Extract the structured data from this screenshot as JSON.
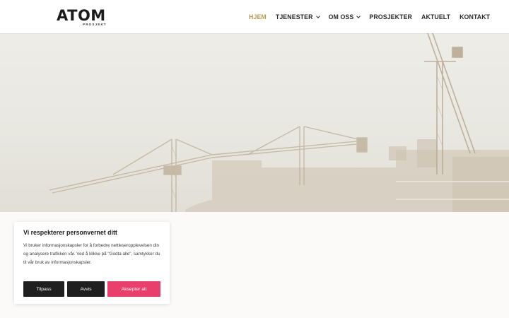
{
  "brand": {
    "name": "ATOM",
    "subtitle": "PROSJEKT"
  },
  "nav": {
    "items": [
      {
        "label": "HJEM",
        "active": true,
        "has_dropdown": false
      },
      {
        "label": "TJENESTER",
        "active": false,
        "has_dropdown": true
      },
      {
        "label": "OM OSS",
        "active": false,
        "has_dropdown": true
      },
      {
        "label": "PROSJEKTER",
        "active": false,
        "has_dropdown": false
      },
      {
        "label": "AKTUELT",
        "active": false,
        "has_dropdown": false
      },
      {
        "label": "KONTAKT",
        "active": false,
        "has_dropdown": false
      }
    ]
  },
  "cookie_banner": {
    "title": "Vi respekterer personvernet ditt",
    "body": "Vi bruker informasjonskapsler for å forbedre nettleseropplevelsen din og analysere trafikken vår. Ved å klikke på \"Godta alle\", samtykker du til vår bruk av informasjonskapsler.",
    "customize_label": "Tilpass",
    "reject_label": "Avvis",
    "accept_label": "Aksepter alt"
  },
  "colors": {
    "accent": "#b49a55",
    "accept_button": "#e93f6d",
    "dark_button": "#1f1f1f"
  }
}
